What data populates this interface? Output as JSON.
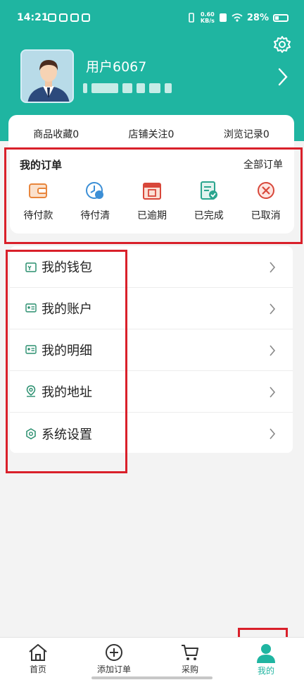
{
  "status_bar": {
    "time": "14:21",
    "net_speed_value": "0.60",
    "net_speed_unit": "KB/s",
    "battery": "28%"
  },
  "header": {
    "username": "用户6067"
  },
  "stats": {
    "favorites": "商品收藏0",
    "shop_follow": "店铺关注0",
    "history": "浏览记录0"
  },
  "orders": {
    "title": "我的订单",
    "all_label": "全部订单",
    "items": [
      {
        "label": "待付款",
        "icon": "wallet-icon"
      },
      {
        "label": "待付清",
        "icon": "clock-payment-icon"
      },
      {
        "label": "已逾期",
        "icon": "overdue-calendar-icon"
      },
      {
        "label": "已完成",
        "icon": "completed-doc-icon"
      },
      {
        "label": "已取消",
        "icon": "cancel-circle-icon"
      }
    ]
  },
  "menu": {
    "items": [
      {
        "label": "我的钱包",
        "icon": "wallet-outline-icon"
      },
      {
        "label": "我的账户",
        "icon": "account-card-icon"
      },
      {
        "label": "我的明细",
        "icon": "detail-card-icon"
      },
      {
        "label": "我的地址",
        "icon": "location-pin-icon"
      },
      {
        "label": "系统设置",
        "icon": "hexagon-settings-icon"
      }
    ]
  },
  "tab_bar": {
    "tabs": [
      {
        "label": "首页",
        "icon": "home-icon"
      },
      {
        "label": "添加订单",
        "icon": "add-circle-icon"
      },
      {
        "label": "采购",
        "icon": "cart-icon"
      },
      {
        "label": "我的",
        "icon": "profile-icon"
      }
    ],
    "active_index": 3
  },
  "colors": {
    "brand": "#1fb5a1",
    "highlight_box": "#d9202a",
    "order_orange": "#e8863d",
    "order_blue": "#3c8fd6",
    "order_red": "#d8473a"
  }
}
